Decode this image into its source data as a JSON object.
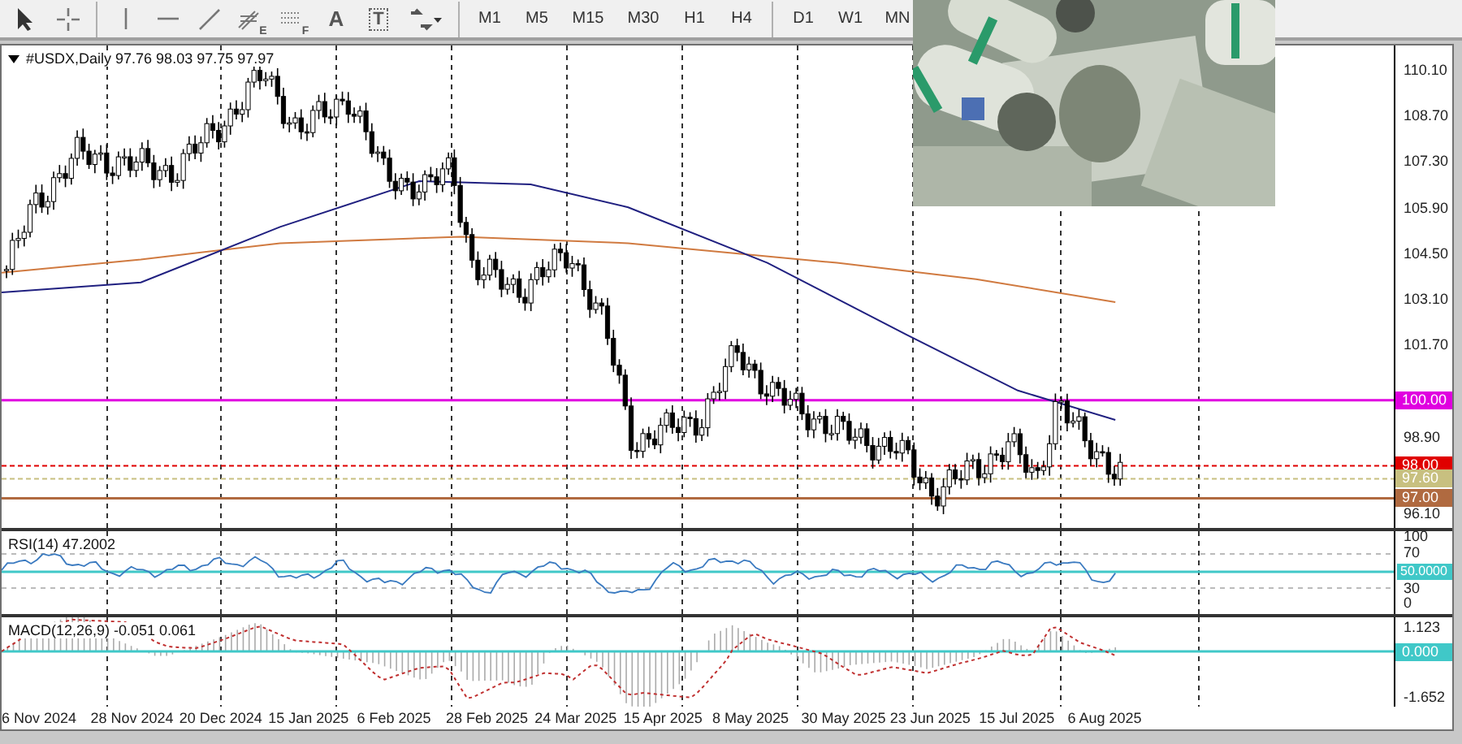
{
  "toolbar": {
    "tools": [
      {
        "kind": "cursor"
      },
      {
        "kind": "crosshair"
      },
      {
        "kind": "separator"
      },
      {
        "kind": "vline"
      },
      {
        "kind": "hline"
      },
      {
        "kind": "trend"
      },
      {
        "kind": "channel",
        "letter": "E"
      },
      {
        "kind": "fibo",
        "letter": "F"
      },
      {
        "kind": "text",
        "letter": "A"
      },
      {
        "kind": "label",
        "letter": "T"
      },
      {
        "kind": "arrows"
      }
    ],
    "timeframes": [
      "M1",
      "M5",
      "M15",
      "M30",
      "H1",
      "H4",
      "D1",
      "W1",
      "MN"
    ]
  },
  "chart": {
    "symbol": "#USDX,Daily",
    "ohlc": "97.76 98.03 97.75 97.97",
    "price_axis": [
      "110.10",
      "108.70",
      "107.30",
      "105.90",
      "104.50",
      "103.10",
      "101.70",
      "98.90",
      "96.10"
    ],
    "levels": [
      {
        "label": "100.00",
        "color": "#e000e0"
      },
      {
        "label": "98.00",
        "color": "#e00000"
      },
      {
        "label": "97.60",
        "color": "#c8c080"
      },
      {
        "label": "97.00",
        "color": "#b06a40"
      }
    ]
  },
  "rsi": {
    "title": "RSI(14) 47.2002",
    "axis": [
      "100",
      "70",
      "30",
      "0"
    ],
    "level_tag": "50.0000"
  },
  "macd": {
    "title": "MACD(12,26,9) -0.051 0.061",
    "axis": [
      "1.123",
      "-1.652"
    ],
    "level_tag": "0.000"
  },
  "dates": [
    "6 Nov 2024",
    "28 Nov 2024",
    "20 Dec 2024",
    "15 Jan 2025",
    "6 Feb 2025",
    "28 Feb 2025",
    "24 Mar 2025",
    "15 Apr 2025",
    "8 May 2025",
    "30 May 2025",
    "23 Jun 2025",
    "15 Jul 2025",
    "6 Aug 2025"
  ]
}
